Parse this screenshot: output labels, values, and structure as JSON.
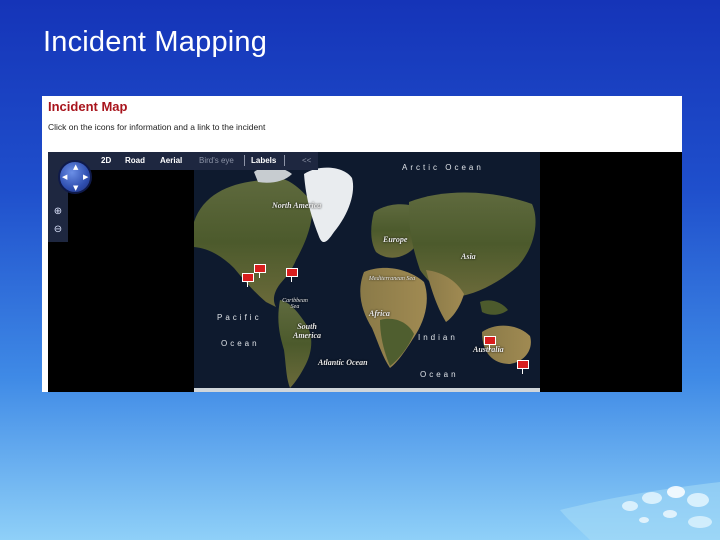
{
  "slide": {
    "title": "Incident Mapping"
  },
  "panel": {
    "title": "Incident Map",
    "subtitle": "Click on the icons for information and a link to the incident"
  },
  "map": {
    "toolbar": {
      "mode_2d": "2D",
      "road": "Road",
      "aerial": "Aerial",
      "birds_eye": "Bird's eye",
      "labels": "Labels",
      "collapse": "<<"
    },
    "icons": {
      "compass": "compass-icon",
      "zoom_in": "zoom-in-icon",
      "zoom_out": "zoom-out-icon",
      "marker": "incident-marker-icon"
    },
    "labels": {
      "arctic": "Arctic Ocean",
      "north_america": "North America",
      "europe": "Europe",
      "asia": "Asia",
      "mediterranean": "Mediterranean Sea",
      "africa": "Africa",
      "caribbean": "Caribbean Sea",
      "south_america": "South America",
      "pacific_1": "Pacific",
      "pacific_2": "Ocean",
      "indian_1": "Indian",
      "indian_2": "Ocean",
      "atlantic": "Atlantic Ocean",
      "australia": "Australia"
    },
    "colors": {
      "marker": "#d81e1e",
      "toolbar": "#1e2740"
    }
  }
}
